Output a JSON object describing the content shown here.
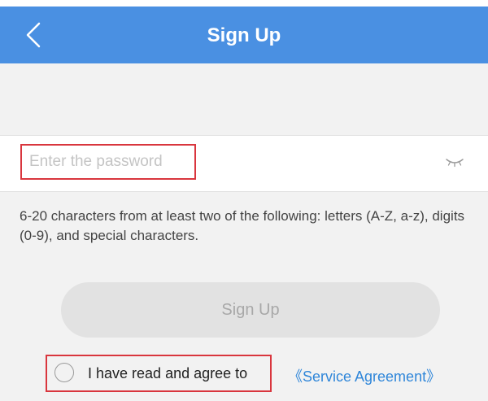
{
  "header": {
    "title": "Sign Up",
    "back_icon": "chevron-left-icon"
  },
  "password": {
    "placeholder": "Enter the password",
    "value": "",
    "visibility_icon": "eye-closed-icon"
  },
  "hint": "6-20 characters from at least two of the following: letters (A-Z, a-z), digits (0-9), and special characters.",
  "signup_button": {
    "label": "Sign Up",
    "enabled": false
  },
  "agreement": {
    "checked": false,
    "text": "I have read and agree to",
    "link_text": "《Service Agreement》"
  },
  "colors": {
    "header_bg": "#4a90e2",
    "highlight": "#d9363e",
    "link": "#2f86d9",
    "button_disabled_bg": "#e2e2e2"
  }
}
